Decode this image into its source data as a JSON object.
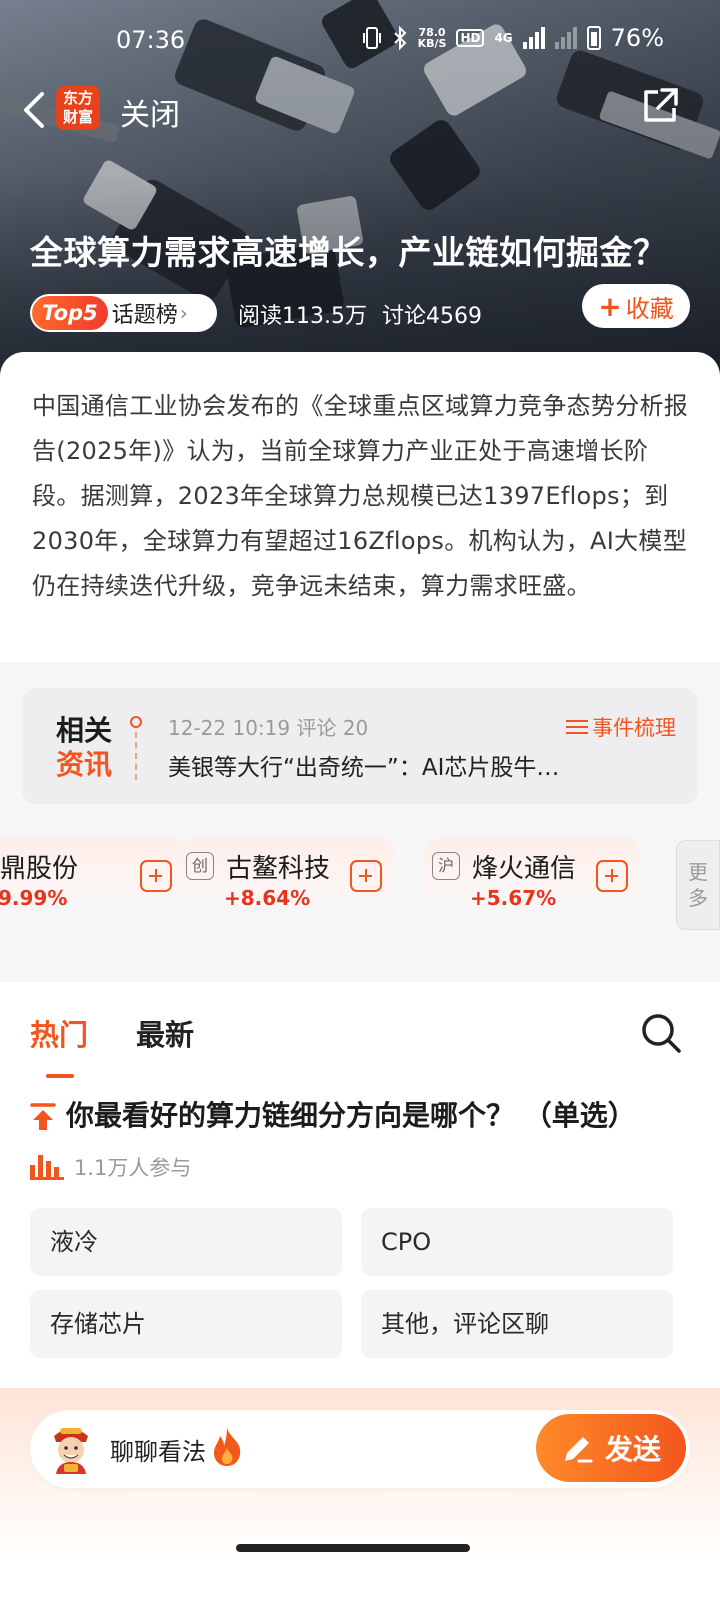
{
  "status_bar": {
    "time": "07:36",
    "net_speed_value": "78.0",
    "net_speed_unit": "KB/S",
    "hd_badge": "HD",
    "network_type": "4G",
    "battery": "76%"
  },
  "nav": {
    "logo_line1": "东方",
    "logo_line2": "财富",
    "close_label": "关闭"
  },
  "topic": {
    "headline": "全球算力需求高速增长，产业链如何掘金？",
    "rank_badge": "Top5",
    "rank_label": "话题榜",
    "reads": "阅读113.5万",
    "discussions": "讨论4569",
    "collect_label": "收藏",
    "intro": "中国通信工业协会发布的《全球重点区域算力竞争态势分析报告(2025年)》认为，当前全球算力产业正处于高速增长阶段。据测算，2023年全球算力总规模已达1397Eflops；到2030年，全球算力有望超过16Zflops。机构认为，AI大模型仍在持续迭代升级，竞争远未结束，算力需求旺盛。"
  },
  "related_news": {
    "badge_line1": "相关",
    "badge_line2": "资讯",
    "meta": "12-22 10:19 评论 20",
    "title": "美银等大行“出奇统一”：AI芯片股牛…",
    "events_label": "事件梳理"
  },
  "stocks": [
    {
      "market": "",
      "name": "鼎股份",
      "change": "9.99%"
    },
    {
      "market": "创",
      "name": "古鳌科技",
      "change": "+8.64%"
    },
    {
      "market": "沪",
      "name": "烽火通信",
      "change": "+5.67%"
    }
  ],
  "more_label_1": "更",
  "more_label_2": "多",
  "tabs": {
    "hot": "热门",
    "latest": "最新"
  },
  "poll": {
    "question": "你最看好的算力链细分方向是哪个？ （单选）",
    "participants": "1.1万人参与",
    "options": [
      "液冷",
      "CPO",
      "存储芯片",
      "其他，评论区聊"
    ]
  },
  "composer": {
    "placeholder": "聊聊看法",
    "send_label": "发送"
  },
  "colors": {
    "accent": "#f2561d",
    "up": "#e8341c",
    "logo": "#e8421a"
  }
}
